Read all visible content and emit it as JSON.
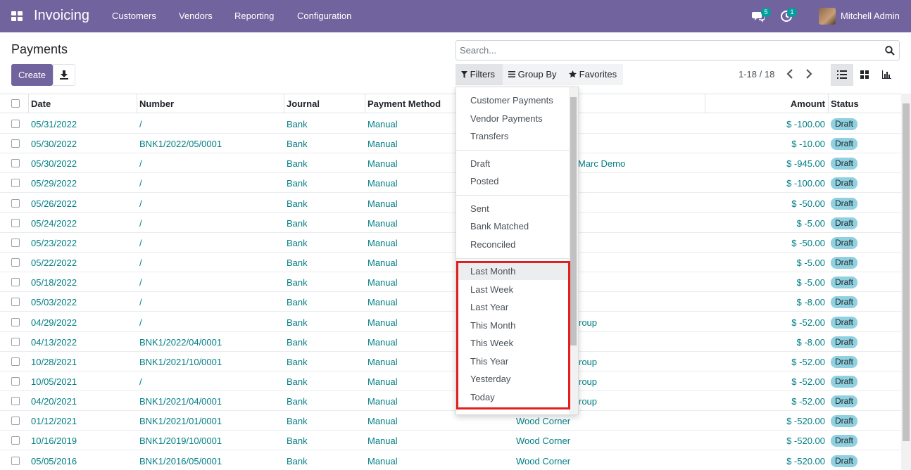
{
  "navbar": {
    "app_name": "Invoicing",
    "menu": [
      "Customers",
      "Vendors",
      "Reporting",
      "Configuration"
    ],
    "messages_count": "5",
    "activities_count": "1",
    "user_name": "Mitchell Admin"
  },
  "control": {
    "title": "Payments",
    "create_label": "Create",
    "search_placeholder": "Search...",
    "filters_label": "Filters",
    "groupby_label": "Group By",
    "favorites_label": "Favorites",
    "pager": "1-18 / 18"
  },
  "table": {
    "headers": {
      "date": "Date",
      "number": "Number",
      "journal": "Journal",
      "payment_method": "Payment Method",
      "amount": "Amount",
      "status": "Status"
    },
    "rows": [
      {
        "date": "05/31/2022",
        "number": "/",
        "journal": "Bank",
        "method": "Manual",
        "partner": "",
        "amount": "$ -100.00",
        "status": "Draft"
      },
      {
        "date": "05/30/2022",
        "number": "BNK1/2022/05/0001",
        "journal": "Bank",
        "method": "Manual",
        "partner": "",
        "amount": "$ -10.00",
        "status": "Draft"
      },
      {
        "date": "05/30/2022",
        "number": "/",
        "journal": "Bank",
        "method": "Manual",
        "partner": "Marc Demo",
        "amount": "$ -945.00",
        "status": "Draft"
      },
      {
        "date": "05/29/2022",
        "number": "/",
        "journal": "Bank",
        "method": "Manual",
        "partner": "",
        "amount": "$ -100.00",
        "status": "Draft"
      },
      {
        "date": "05/26/2022",
        "number": "/",
        "journal": "Bank",
        "method": "Manual",
        "partner": "",
        "amount": "$ -50.00",
        "status": "Draft"
      },
      {
        "date": "05/24/2022",
        "number": "/",
        "journal": "Bank",
        "method": "Manual",
        "partner": "",
        "amount": "$ -5.00",
        "status": "Draft"
      },
      {
        "date": "05/23/2022",
        "number": "/",
        "journal": "Bank",
        "method": "Manual",
        "partner": "",
        "amount": "$ -50.00",
        "status": "Draft"
      },
      {
        "date": "05/22/2022",
        "number": "/",
        "journal": "Bank",
        "method": "Manual",
        "partner": "",
        "amount": "$ -5.00",
        "status": "Draft"
      },
      {
        "date": "05/18/2022",
        "number": "/",
        "journal": "Bank",
        "method": "Manual",
        "partner": "",
        "amount": "$ -5.00",
        "status": "Draft"
      },
      {
        "date": "05/03/2022",
        "number": "/",
        "journal": "Bank",
        "method": "Manual",
        "partner": "",
        "amount": "$ -8.00",
        "status": "Draft"
      },
      {
        "date": "04/29/2022",
        "number": "/",
        "journal": "Bank",
        "method": "Manual",
        "partner": "roup",
        "amount": "$ -52.00",
        "status": "Draft"
      },
      {
        "date": "04/13/2022",
        "number": "BNK1/2022/04/0001",
        "journal": "Bank",
        "method": "Manual",
        "partner": "",
        "amount": "$ -8.00",
        "status": "Draft"
      },
      {
        "date": "10/28/2021",
        "number": "BNK1/2021/10/0001",
        "journal": "Bank",
        "method": "Manual",
        "partner": "roup",
        "amount": "$ -52.00",
        "status": "Draft"
      },
      {
        "date": "10/05/2021",
        "number": "/",
        "journal": "Bank",
        "method": "Manual",
        "partner": "roup",
        "amount": "$ -52.00",
        "status": "Draft"
      },
      {
        "date": "04/20/2021",
        "number": "BNK1/2021/04/0001",
        "journal": "Bank",
        "method": "Manual",
        "partner": "roup",
        "amount": "$ -52.00",
        "status": "Draft"
      },
      {
        "date": "01/12/2021",
        "number": "BNK1/2021/01/0001",
        "journal": "Bank",
        "method": "Manual",
        "partner": "Wood Corner",
        "amount": "$ -520.00",
        "status": "Draft"
      },
      {
        "date": "10/16/2019",
        "number": "BNK1/2019/10/0001",
        "journal": "Bank",
        "method": "Manual",
        "partner": "Wood Corner",
        "amount": "$ -520.00",
        "status": "Draft"
      },
      {
        "date": "05/05/2016",
        "number": "BNK1/2016/05/0001",
        "journal": "Bank",
        "method": "Manual",
        "partner": "Wood Corner",
        "amount": "$ -520.00",
        "status": "Draft"
      }
    ]
  },
  "filters_menu": {
    "group1": [
      "Customer Payments",
      "Vendor Payments",
      "Transfers"
    ],
    "group2": [
      "Draft",
      "Posted"
    ],
    "group3": [
      "Sent",
      "Bank Matched",
      "Reconciled"
    ],
    "group4": [
      "Last Month",
      "Last Week",
      "Last Year",
      "This Month",
      "This Week",
      "This Year",
      "Yesterday",
      "Today"
    ]
  },
  "colors": {
    "brand": "#71639e",
    "link": "#017e84",
    "badge": "#8fd1e0",
    "highlight": "#e31e1e"
  }
}
